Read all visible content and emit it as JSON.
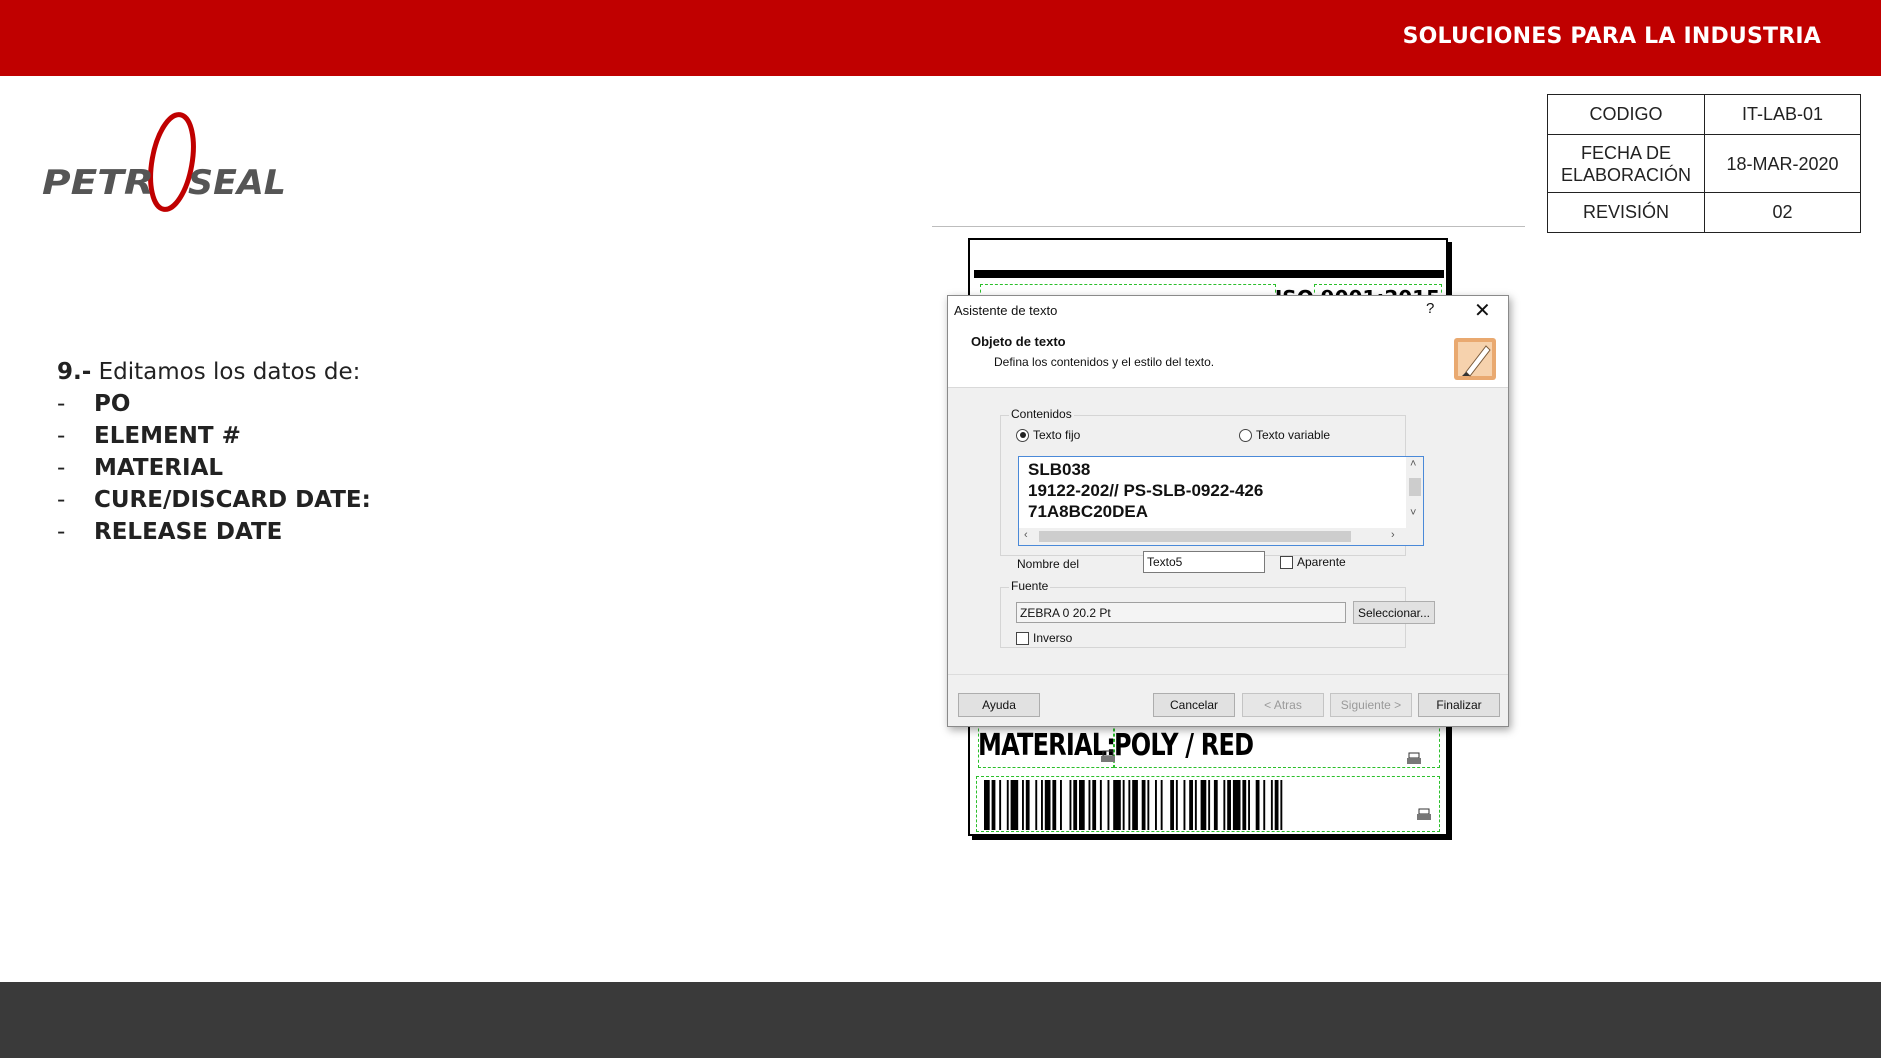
{
  "header": {
    "tagline": "SOLUCIONES PARA LA INDUSTRIA",
    "color": "#c00000"
  },
  "footer": {
    "color": "#3a3a3a"
  },
  "logo": {
    "text_left": "PETR",
    "text_right": "SEAL",
    "icon": "petroseal-logo"
  },
  "doc_info": {
    "codigo_label": "CODIGO",
    "codigo_value": "IT-LAB-01",
    "fecha_label_1": "FECHA DE",
    "fecha_label_2": "ELABORACIÓN",
    "fecha_value": "18-MAR-2020",
    "revision_label": "REVISIÓN",
    "revision_value": "02"
  },
  "steps": {
    "number": "9.-",
    "intro": " Editamos los datos de:",
    "dash": "-",
    "items": [
      "PO",
      "ELEMENT #",
      "MATERIAL",
      "CURE/DISCARD DATE:",
      "RELEASE DATE"
    ]
  },
  "label_preview": {
    "iso_text": "ISO 9001:2015",
    "material_key": "MATERIAL:",
    "material_value": "POLY / RED"
  },
  "dialog": {
    "title": "Asistente de texto",
    "help": "?",
    "close": "✕",
    "heading": "Objeto de texto",
    "subheading": "Defina los contenidos y el estilo del texto.",
    "contents_legend": "Contenidos",
    "radio_fixed": "Texto fijo",
    "radio_variable": "Texto variable",
    "text_lines": [
      "SLB038",
      "19122-202// PS-SLB-0922-426",
      "71A8BC20DEA"
    ],
    "name_label": "Nombre del",
    "name_value": "Texto5",
    "apparent_label": "Aparente",
    "font_legend": "Fuente",
    "font_value": "ZEBRA 0 20.2 Pt",
    "select_button": "Seleccionar...",
    "inverse_label": "Inverso",
    "help_button": "Ayuda",
    "cancel_button": "Cancelar",
    "back_button": "< Atras",
    "next_button": "Siguiente >",
    "finish_button": "Finalizar"
  }
}
